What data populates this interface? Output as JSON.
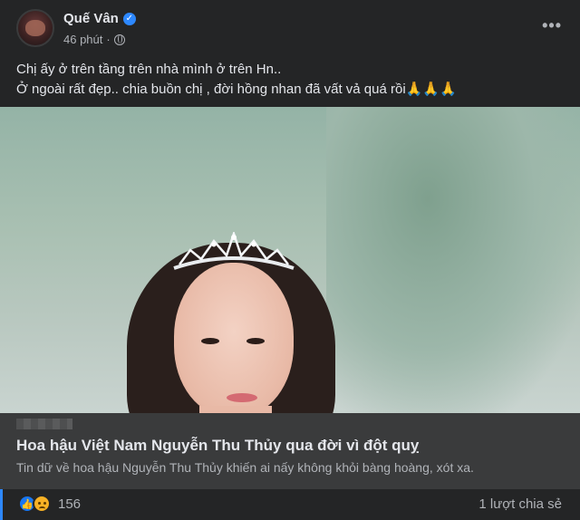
{
  "post": {
    "author": "Quế Vân",
    "verified": true,
    "time": "46 phút",
    "separator": "·",
    "privacy_icon": "globe-icon",
    "more_icon": "•••",
    "text_lines": [
      "Chị ấy ở trên tầng trên nhà mình ở trên Hn..",
      "Ở ngoài rất đẹp.. chia buồn chị , đời hồng nhan đã vất vả quá rồi🙏🙏🙏"
    ]
  },
  "link": {
    "title": "Hoa hậu Việt Nam Nguyễn Thu Thủy qua đời vì đột quỵ",
    "description": "Tin dữ về hoa hậu Nguyễn Thu Thủy khiến ai nấy không khỏi bàng hoàng, xót xa.",
    "info_icon": "i"
  },
  "footer": {
    "reaction_count": "156",
    "shares": "1 lượt chia sẻ",
    "like_glyph": "👍"
  },
  "colors": {
    "background": "#242526",
    "link_box": "#3a3b3c",
    "accent": "#2d88ff"
  }
}
